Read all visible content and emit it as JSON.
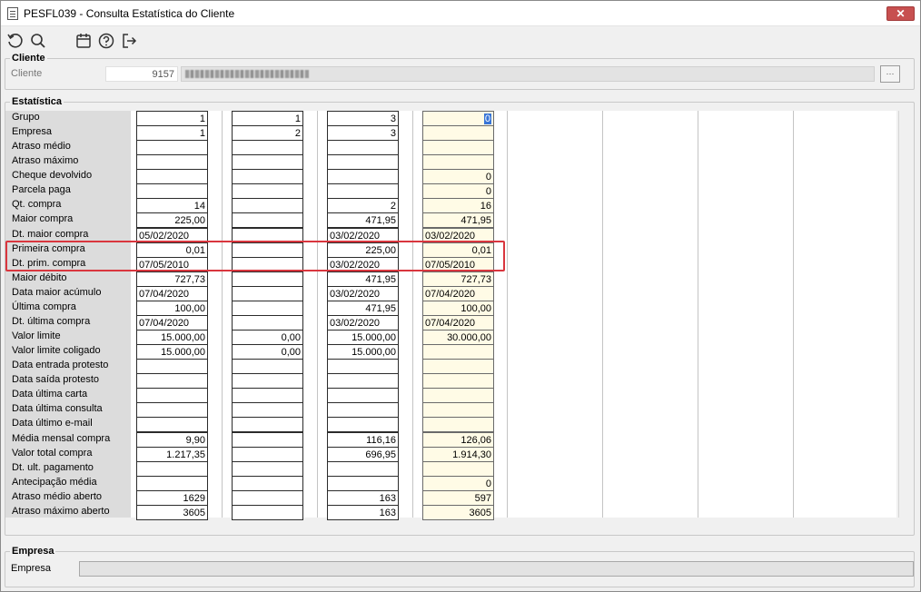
{
  "window": {
    "title": "PESFL039 - Consulta Estatística do Cliente",
    "close_label": "✕"
  },
  "toolbar": {
    "icons": [
      "refresh-icon",
      "search-icon",
      "calendar-icon",
      "help-icon",
      "exit-icon"
    ]
  },
  "cliente": {
    "legend": "Cliente",
    "label": "Cliente",
    "code": "9157",
    "lookup_label": "···"
  },
  "estatistica": {
    "legend": "Estatística",
    "rows": [
      "Grupo",
      "Empresa",
      "Atraso médio",
      "Atraso máximo",
      "Cheque devolvido",
      "Parcela paga",
      "Qt. compra",
      "Maior compra",
      "Dt. maior compra",
      "Primeira compra",
      "Dt. prim. compra",
      "Maior débito",
      "Data maior acúmulo",
      "Última compra",
      "Dt. última compra",
      "Valor limite",
      "Valor limite coligado",
      "Data entrada protesto",
      "Data saída protesto",
      "Data última carta",
      "Data última consulta",
      "Data último e-mail",
      "Média mensal compra",
      "Valor total compra",
      "Dt. ult. pagamento",
      "Antecipação média",
      "Atraso médio aberto",
      "Atraso máximo aberto"
    ],
    "columns": [
      {
        "values": [
          "1",
          "1",
          "",
          "",
          "",
          "",
          "14",
          "225,00",
          "05/02/2020",
          "0,01",
          "07/05/2010",
          "727,73",
          "07/04/2020",
          "100,00",
          "07/04/2020",
          "15.000,00",
          "15.000,00",
          "",
          "",
          "",
          "",
          "",
          "9,90",
          "1.217,35",
          "",
          "",
          "1629",
          "3605"
        ]
      },
      {
        "values": [
          "1",
          "2",
          "",
          "",
          "",
          "",
          "",
          "",
          "",
          "",
          "",
          "",
          "",
          "",
          "",
          "0,00",
          "0,00",
          "",
          "",
          "",
          "",
          "",
          "",
          "",
          "",
          "",
          "",
          ""
        ]
      },
      {
        "values": [
          "3",
          "3",
          "",
          "",
          "",
          "",
          "2",
          "471,95",
          "03/02/2020",
          "225,00",
          "03/02/2020",
          "471,95",
          "03/02/2020",
          "471,95",
          "03/02/2020",
          "15.000,00",
          "15.000,00",
          "",
          "",
          "",
          "",
          "",
          "116,16",
          "696,95",
          "",
          "",
          "163",
          "163"
        ]
      },
      {
        "values": [
          "0",
          "",
          "",
          "",
          "0",
          "0",
          "16",
          "471,95",
          "03/02/2020",
          "0,01",
          "07/05/2010",
          "727,73",
          "07/04/2020",
          "100,00",
          "07/04/2020",
          "30.000,00",
          "",
          "",
          "",
          "",
          "",
          "",
          "126,06",
          "1.914,30",
          "",
          "0",
          "597",
          "3605"
        ]
      }
    ],
    "date_rows": [
      8,
      10,
      12,
      14
    ]
  },
  "empresa": {
    "legend": "Empresa",
    "label": "Empresa"
  },
  "colors": {
    "highlight": "#d9363e",
    "summary_col": "#fffbe6",
    "focus": "#3875d7"
  }
}
